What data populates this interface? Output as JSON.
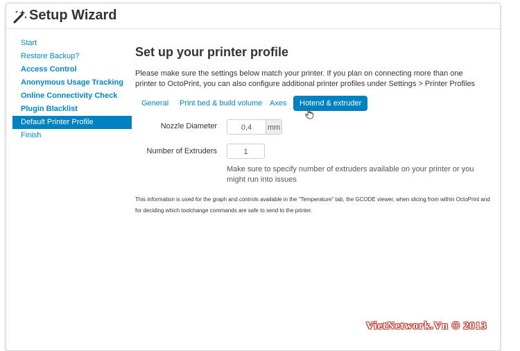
{
  "header": {
    "title": "Setup Wizard",
    "icon": "magic-wand-icon"
  },
  "nav": {
    "items": [
      {
        "label": "Start"
      },
      {
        "label": "Restore Backup?"
      },
      {
        "label": "Access Control"
      },
      {
        "label": "Anonymous Usage Tracking"
      },
      {
        "label": "Online Connectivity Check"
      },
      {
        "label": "Plugin Blacklist"
      },
      {
        "label": "Default Printer Profile"
      },
      {
        "label": "Finish"
      }
    ]
  },
  "main": {
    "heading": "Set up your printer profile",
    "intro": "Please make sure the settings below match your printer. If you plan on connecting more than one printer to OctoPrint, you can also configure additional printer profiles under Settings > Printer Profiles",
    "tabs": [
      {
        "label": "General"
      },
      {
        "label": "Print bed & build volume"
      },
      {
        "label": "Axes"
      },
      {
        "label": "Hotend & extruder"
      }
    ],
    "fields": {
      "nozzle_label": "Nozzle Diameter",
      "nozzle_value": "0,4",
      "nozzle_unit": "mm",
      "extruders_label": "Number of Extruders",
      "extruders_value": "1",
      "extruders_help": "Make sure to specify number of extruders available on your printer or you might run into issues"
    },
    "note": "This information is used for the graph and controls available in the \"Temperature\" tab, the GCODE viewer, when slicing from within OctoPrint and for deciding which toolchange commands are safe to send to the printer."
  },
  "watermark": "VietNetwork.Vn © 2013",
  "colors": {
    "accent": "#0081c2",
    "link": "#0088cc"
  }
}
